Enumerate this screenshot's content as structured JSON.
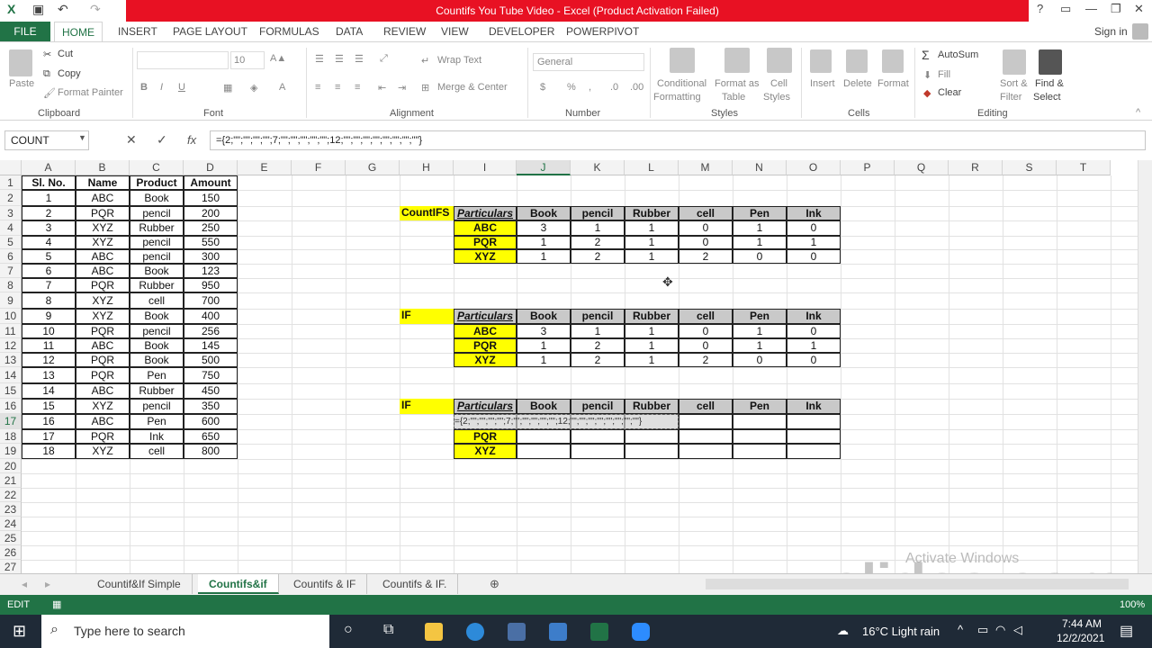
{
  "title_bar": {
    "title": "Countifs You Tube Video - Excel (Product Activation Failed)"
  },
  "ribbon_tabs": [
    "FILE",
    "HOME",
    "INSERT",
    "PAGE LAYOUT",
    "FORMULAS",
    "DATA",
    "REVIEW",
    "VIEW",
    "DEVELOPER",
    "POWERPIVOT"
  ],
  "sign_in": "Sign in",
  "clipboard": {
    "paste": "Paste",
    "cut": "Cut",
    "copy": "Copy",
    "format_painter": "Format Painter",
    "label": "Clipboard"
  },
  "font": {
    "size": "10",
    "label": "Font",
    "b": "B",
    "i": "I",
    "u": "U"
  },
  "alignment": {
    "wrap": "Wrap Text",
    "merge": "Merge & Center",
    "label": "Alignment"
  },
  "number": {
    "format": "General",
    "label": "Number",
    "currency": "$",
    "percent": "%",
    "comma": ","
  },
  "styles": {
    "cond1": "Conditional",
    "cond2": "Formatting",
    "fmt1": "Format as",
    "fmt2": "Table",
    "cell1": "Cell",
    "cell2": "Styles",
    "label": "Styles"
  },
  "cells": {
    "insert": "Insert",
    "delete": "Delete",
    "format": "Format",
    "label": "Cells"
  },
  "editing": {
    "autosum": "AutoSum",
    "fill": "Fill",
    "clear": "Clear",
    "sort1": "Sort &",
    "sort2": "Filter",
    "find1": "Find &",
    "find2": "Select",
    "label": "Editing"
  },
  "formula_bar": {
    "name_box": "COUNT",
    "fx": "fx",
    "formula": "={2;\"\";\"\";\"\";\"\";7;\"\";\"\";\"\";\"\";\"\";12;\"\";\"\";\"\";\"\";\"\";\"\";\"\";\"\"}"
  },
  "columns": [
    "A",
    "B",
    "C",
    "D",
    "E",
    "F",
    "G",
    "H",
    "I",
    "J",
    "K",
    "L",
    "M",
    "N",
    "O",
    "P",
    "Q",
    "R",
    "S",
    "T"
  ],
  "rows": [
    "1",
    "2",
    "3",
    "4",
    "5",
    "6",
    "7",
    "8",
    "9",
    "10",
    "11",
    "12",
    "13",
    "14",
    "15",
    "16",
    "17",
    "18",
    "19",
    "20",
    "21",
    "22",
    "23",
    "24",
    "25",
    "26",
    "27"
  ],
  "main_table": {
    "headers": [
      "Sl. No.",
      "Name",
      "Product",
      "Amount"
    ],
    "rows": [
      [
        "1",
        "ABC",
        "Book",
        "150"
      ],
      [
        "2",
        "PQR",
        "pencil",
        "200"
      ],
      [
        "3",
        "XYZ",
        "Rubber",
        "250"
      ],
      [
        "4",
        "XYZ",
        "pencil",
        "550"
      ],
      [
        "5",
        "ABC",
        "pencil",
        "300"
      ],
      [
        "6",
        "ABC",
        "Book",
        "123"
      ],
      [
        "7",
        "PQR",
        "Rubber",
        "950"
      ],
      [
        "8",
        "XYZ",
        "cell",
        "700"
      ],
      [
        "9",
        "XYZ",
        "Book",
        "400"
      ],
      [
        "10",
        "PQR",
        "pencil",
        "256"
      ],
      [
        "11",
        "ABC",
        "Book",
        "145"
      ],
      [
        "12",
        "PQR",
        "Book",
        "500"
      ],
      [
        "13",
        "PQR",
        "Pen",
        "750"
      ],
      [
        "14",
        "ABC",
        "Rubber",
        "450"
      ],
      [
        "15",
        "XYZ",
        "pencil",
        "350"
      ],
      [
        "16",
        "ABC",
        "Pen",
        "600"
      ],
      [
        "17",
        "PQR",
        "Ink",
        "650"
      ],
      [
        "18",
        "XYZ",
        "cell",
        "800"
      ]
    ]
  },
  "pivot1": {
    "label": "CountIFS",
    "particulars": "Particulars",
    "cols": [
      "Book",
      "pencil",
      "Rubber",
      "cell",
      "Pen",
      "Ink"
    ],
    "rows": [
      [
        "ABC",
        "3",
        "1",
        "1",
        "0",
        "1",
        "0"
      ],
      [
        "PQR",
        "1",
        "2",
        "1",
        "0",
        "1",
        "1"
      ],
      [
        "XYZ",
        "1",
        "2",
        "1",
        "2",
        "0",
        "0"
      ]
    ]
  },
  "pivot2": {
    "label": "IF",
    "particulars": "Particulars",
    "cols": [
      "Book",
      "pencil",
      "Rubber",
      "cell",
      "Pen",
      "Ink"
    ],
    "rows": [
      [
        "ABC",
        "3",
        "1",
        "1",
        "0",
        "1",
        "0"
      ],
      [
        "PQR",
        "1",
        "2",
        "1",
        "0",
        "1",
        "1"
      ],
      [
        "XYZ",
        "1",
        "2",
        "1",
        "2",
        "0",
        "0"
      ]
    ]
  },
  "pivot3": {
    "label": "IF",
    "particulars": "Particulars",
    "cols": [
      "Book",
      "pencil",
      "Rubber",
      "cell",
      "Pen",
      "Ink"
    ],
    "edit_text": "={2;\"\";\"\";\"\";\"\";7;\"\";\"\";\"\";\"\";\"\";12;\"\";\"\";\"\";\"\";\"\";\"\";\"\";\"\"}",
    "rows": [
      "PQR",
      "XYZ"
    ]
  },
  "sheet_tabs": [
    "Countif&If Simple",
    "Countifs&if",
    "Countifs & IF",
    "Countifs & IF."
  ],
  "status": {
    "mode": "EDIT",
    "zoom": "100%"
  },
  "watermark": {
    "activate": "Activate Windows",
    "brand": "clideo.com"
  },
  "taskbar": {
    "search": "Type here to search",
    "weather": "16°C  Light rain",
    "time": "7:44 AM",
    "date": "12/2/2021"
  }
}
